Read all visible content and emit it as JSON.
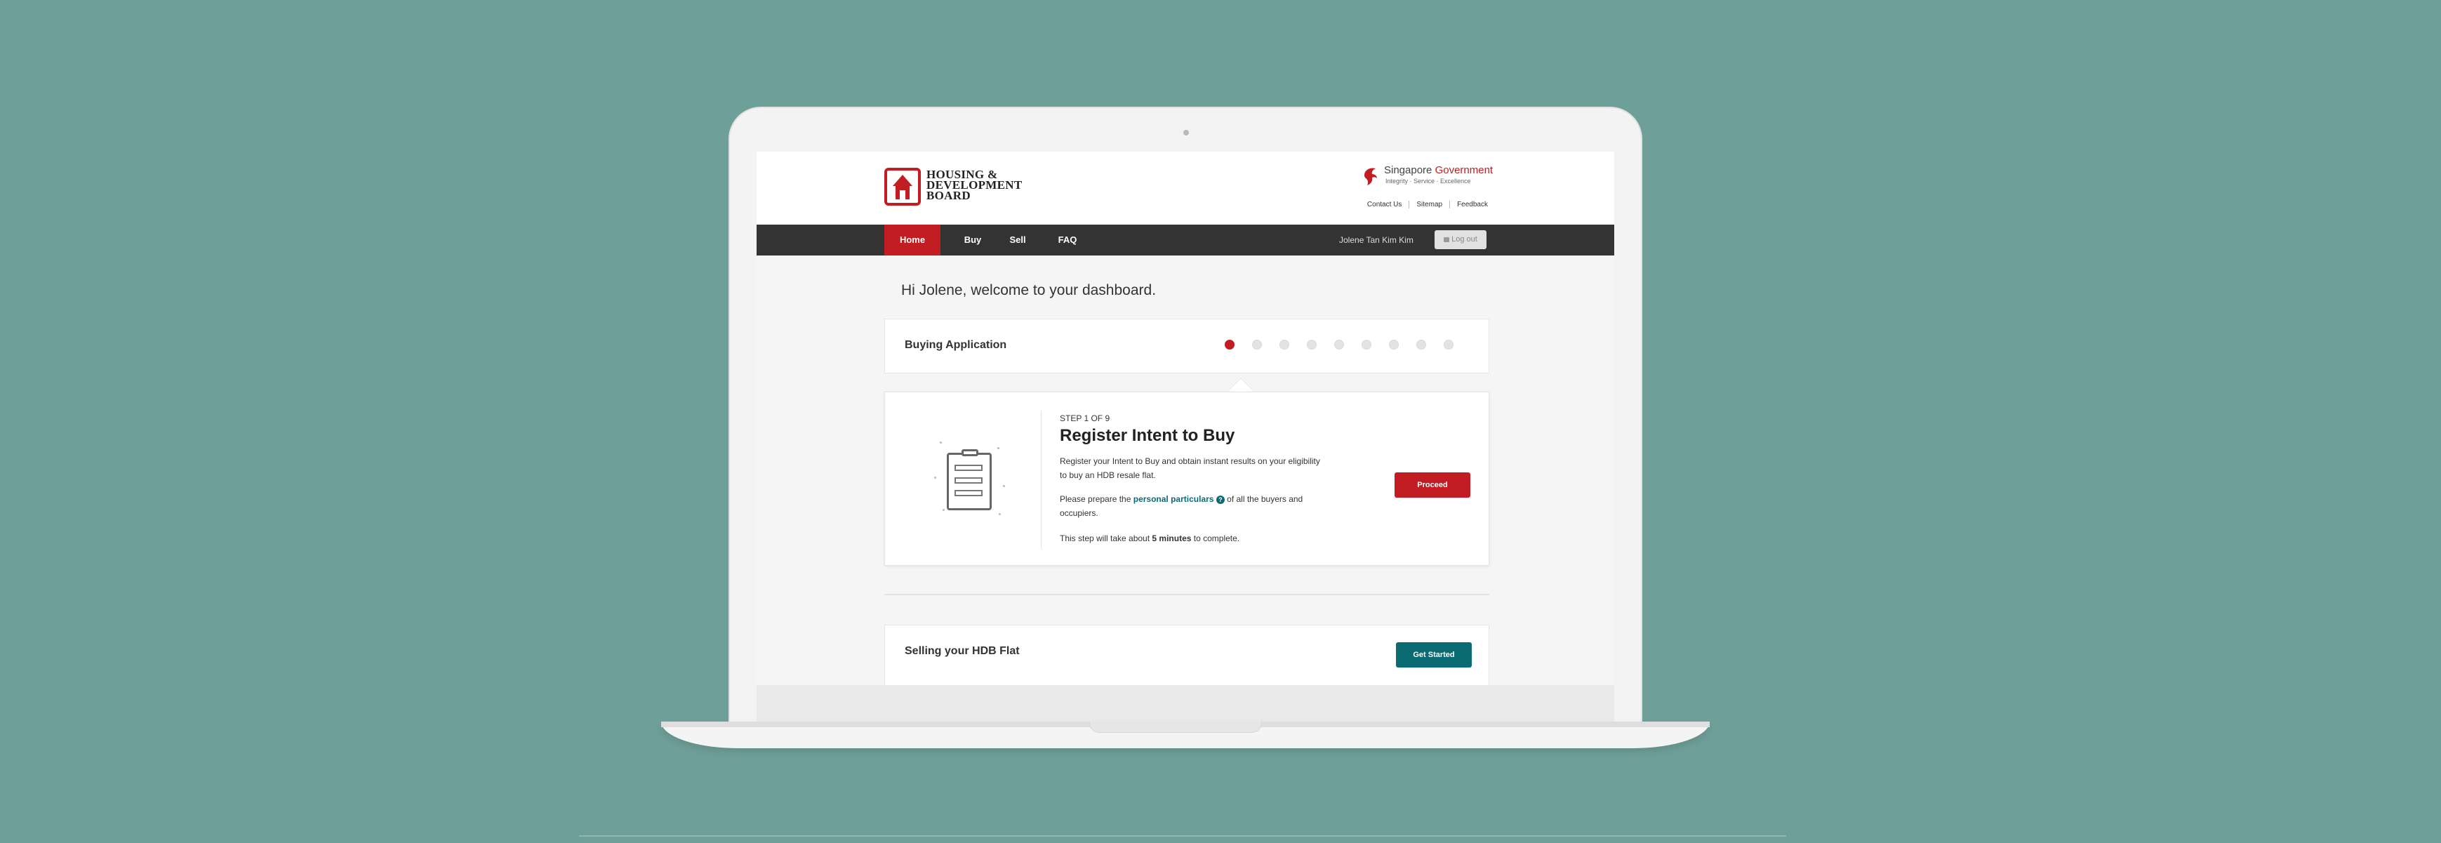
{
  "brand": {
    "logo_lines": [
      "HOUSING &",
      "DEVELOPMENT",
      "BOARD"
    ],
    "gov_title_part1": "Singapore ",
    "gov_title_part2": "Government",
    "gov_tagline": "Integrity · Service · Excellence"
  },
  "utility_links": [
    "Contact Us",
    "Sitemap",
    "Feedback"
  ],
  "nav": {
    "items": [
      "Home",
      "Buy",
      "Sell",
      "FAQ"
    ],
    "active": "Home",
    "user_name": "Jolene Tan Kim Kim",
    "logout_label": "Log out"
  },
  "dashboard": {
    "greeting": "Hi Jolene, welcome to your dashboard.",
    "buying_title": "Buying Application",
    "steps_total": 9,
    "current_step": 1,
    "step": {
      "label": "STEP 1 OF 9",
      "title": "Register Intent to Buy",
      "desc": "Register your Intent to Buy and obtain instant results on your eligibility to buy an HDB resale flat.",
      "prepare_before": "Please prepare the ",
      "prepare_link": "personal particulars",
      "prepare_help": "?",
      "prepare_after": " of all the buyers and occupiers.",
      "time_before": "This step will take about ",
      "time_value": "5 minutes",
      "time_after": " to complete.",
      "button": "Proceed"
    },
    "selling_title": "Selling your HDB Flat",
    "selling_button": "Get Started"
  },
  "colors": {
    "background": "#6f9f99",
    "brand_red": "#c21d22",
    "teal": "#0b6b72",
    "nav_dark": "#333333"
  },
  "icons": [
    "lock-icon",
    "help-icon",
    "clipboard-icon",
    "singapore-lion-icon",
    "hdb-house-icon"
  ]
}
